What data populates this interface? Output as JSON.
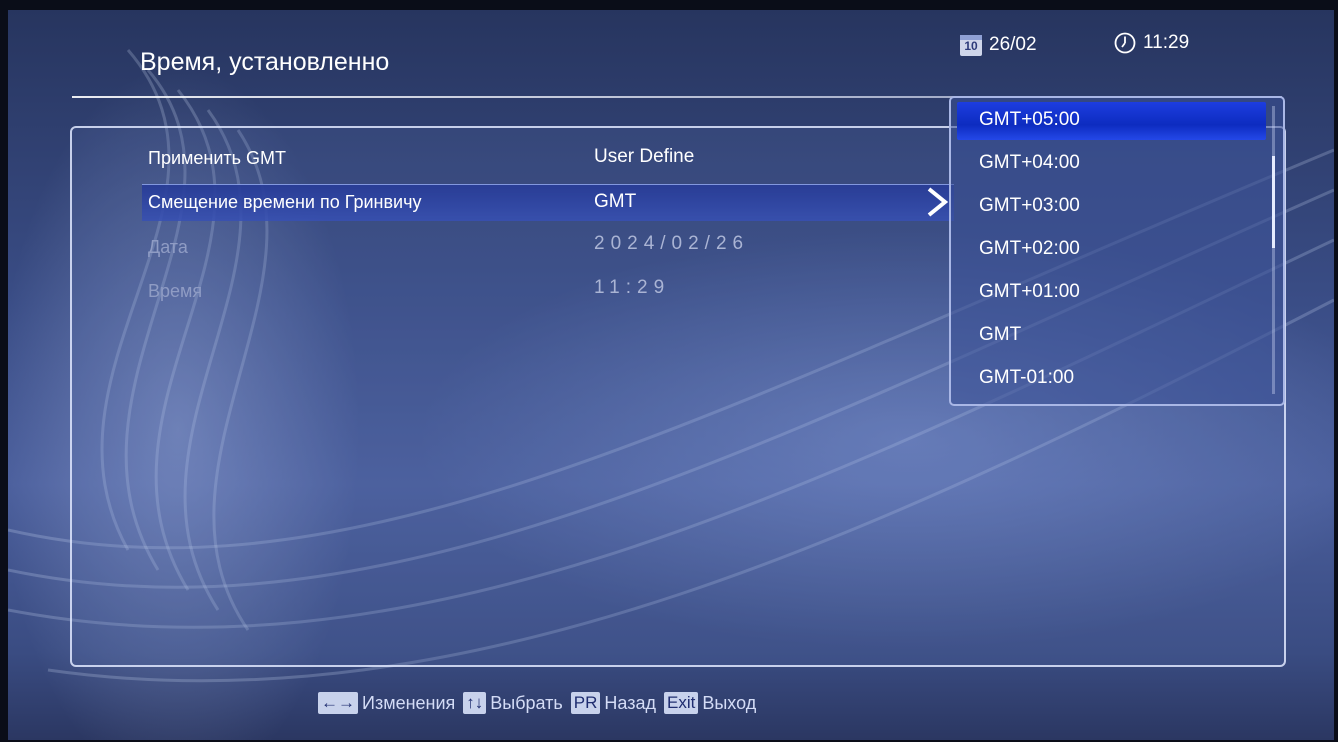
{
  "header": {
    "title": "Время, установленно",
    "date": "26/02",
    "calendar_icon_text": "10",
    "time": "11:29"
  },
  "settings": {
    "rows": [
      {
        "label": "Применить GMT",
        "value": "User Define"
      },
      {
        "label": "Смещение времени по Гринвичу",
        "value": "GMT"
      },
      {
        "label": "Дата",
        "value": "2024/02/26"
      },
      {
        "label": "Время",
        "value": "11:29"
      }
    ]
  },
  "dropdown": {
    "items": [
      "GMT+05:00",
      "GMT+04:00",
      "GMT+03:00",
      "GMT+02:00",
      "GMT+01:00",
      "GMT",
      "GMT-01:00"
    ],
    "selected": "GMT+05:00"
  },
  "footer": {
    "hints": [
      {
        "key": "←→",
        "label": "Изменения"
      },
      {
        "key": "↑↓",
        "label": "Выбрать"
      },
      {
        "key": "PR",
        "label": "Назад"
      },
      {
        "key": "Exit",
        "label": "Выход"
      }
    ]
  },
  "colors": {
    "background": "#3a4d86",
    "selection": "#1d3de0",
    "text": "#ffffff"
  }
}
